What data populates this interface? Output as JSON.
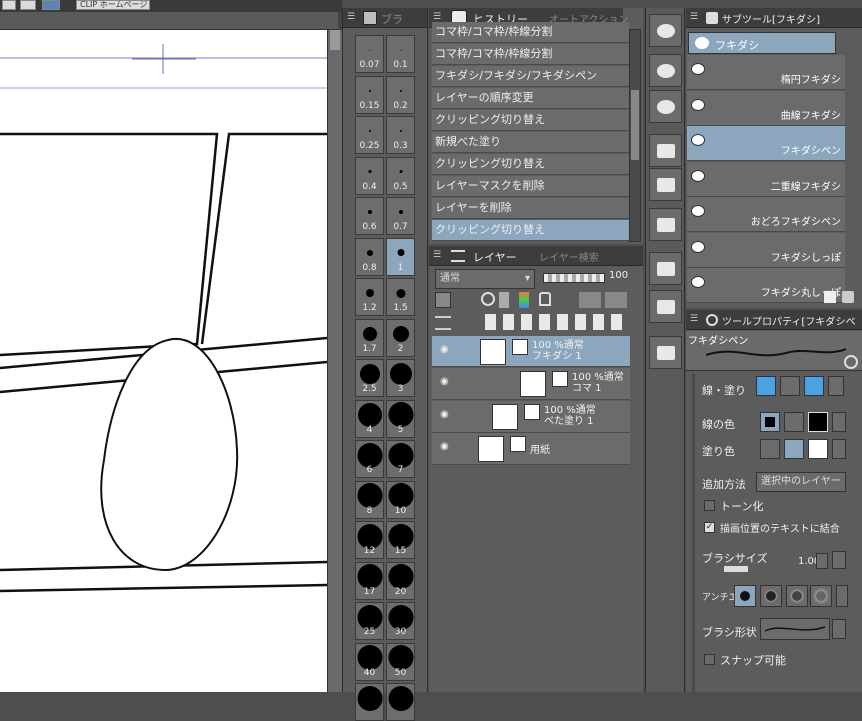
{
  "top_strip": {
    "homepage_button": "CLIP ホームページ"
  },
  "brush_panel": {
    "title": "ブラ",
    "sizes": [
      {
        "label": "0.07",
        "d": 1
      },
      {
        "label": "0.1",
        "d": 1
      },
      {
        "label": "0.15",
        "d": 2
      },
      {
        "label": "0.2",
        "d": 2
      },
      {
        "label": "0.25",
        "d": 2
      },
      {
        "label": "0.3",
        "d": 2
      },
      {
        "label": "0.4",
        "d": 3
      },
      {
        "label": "0.5",
        "d": 3
      },
      {
        "label": "0.6",
        "d": 4
      },
      {
        "label": "0.7",
        "d": 4
      },
      {
        "label": "0.8",
        "d": 6
      },
      {
        "label": "1",
        "d": 7
      },
      {
        "label": "1.2",
        "d": 8
      },
      {
        "label": "1.5",
        "d": 9
      },
      {
        "label": "1.7",
        "d": 14
      },
      {
        "label": "2",
        "d": 16
      },
      {
        "label": "2.5",
        "d": 20
      },
      {
        "label": "3",
        "d": 22
      },
      {
        "label": "4",
        "d": 24
      },
      {
        "label": "5",
        "d": 25
      },
      {
        "label": "6",
        "d": 25
      },
      {
        "label": "7",
        "d": 25
      },
      {
        "label": "8",
        "d": 25
      },
      {
        "label": "10",
        "d": 25
      },
      {
        "label": "12",
        "d": 25
      },
      {
        "label": "15",
        "d": 25
      },
      {
        "label": "17",
        "d": 25
      },
      {
        "label": "20",
        "d": 25
      },
      {
        "label": "25",
        "d": 25
      },
      {
        "label": "30",
        "d": 25
      },
      {
        "label": "40",
        "d": 25
      },
      {
        "label": "50",
        "d": 25
      },
      {
        "label": "",
        "d": 25
      },
      {
        "label": "",
        "d": 25
      }
    ],
    "selected_index": 11
  },
  "history": {
    "tab_active": "ヒストリー",
    "tab_inactive": "オートアクション",
    "items": [
      "コマ枠/コマ枠/枠線分割",
      "コマ枠/コマ枠/枠線分割",
      "フキダシ/フキダシ/フキダシペン",
      "レイヤーの順序変更",
      "クリッピング切り替え",
      "新規べた塗り",
      "クリッピング切り替え",
      "レイヤーマスクを削除",
      "レイヤーを削除",
      "クリッピング切り替え"
    ],
    "selected_index": 9
  },
  "layers": {
    "tab_active": "レイヤー",
    "tab_inactive": "レイヤー検索",
    "blend_mode": "通常",
    "opacity": "100",
    "rows": [
      {
        "line1": "100 %通常",
        "line2": "フキダシ 1",
        "selected": true
      },
      {
        "line1": "100 %通常",
        "line2": "コマ 1",
        "selected": false
      },
      {
        "line1": "100 %通常",
        "line2": "べた塗り 1",
        "selected": false
      },
      {
        "line1": "",
        "line2": "用紙",
        "selected": false
      }
    ]
  },
  "subtool": {
    "title": "サブツール[フキダシ]",
    "group_button": "フキダシ",
    "items": [
      {
        "label": "楕円フキダシ",
        "selected": false
      },
      {
        "label": "曲線フキダシ",
        "selected": false
      },
      {
        "label": "フキダシペン",
        "selected": true
      },
      {
        "label": "二重線フキダシ",
        "selected": false
      },
      {
        "label": "おどろフキダシペン",
        "selected": false
      },
      {
        "label": "フキダシしっぽ",
        "selected": false
      },
      {
        "label": "フキダシ丸しっぽ",
        "selected": false
      }
    ]
  },
  "tool_property": {
    "title": "ツールプロパティ[フキダシペ",
    "preview_label": "フキダシペン",
    "line_fill_label": "線・塗り",
    "line_color_label": "線の色",
    "fill_color_label": "塗り色",
    "add_method_label": "追加方法",
    "add_method_value": "選択中のレイヤー",
    "tone_label": "トーン化",
    "tone_checked": false,
    "merge_text_label": "描画位置のテキストに結合",
    "merge_text_checked": true,
    "brush_size_label": "ブラシサイズ",
    "brush_size_value": "1.00",
    "antialias_label": "アンチエ",
    "brush_shape_label": "ブラシ形状",
    "snap_label": "スナップ可能",
    "snap_checked": false
  },
  "colors": {
    "selection": "#8ca6bd",
    "panel": "#5c5c5c",
    "accent_blue": "#4aa3e0"
  }
}
